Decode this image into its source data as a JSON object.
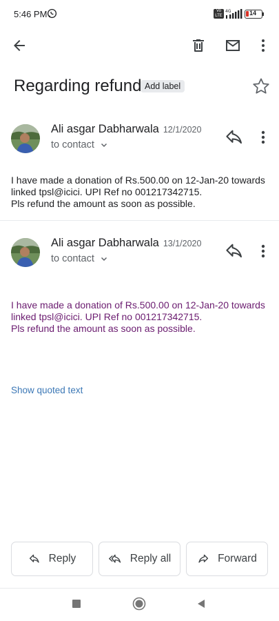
{
  "status_bar": {
    "time": "5:46 PM",
    "network_badge_line1": "Vo",
    "network_badge_line2": "LTE",
    "network_type": "4G",
    "battery": "14"
  },
  "toolbar": {
    "icons": [
      "back-arrow-icon",
      "trash-icon",
      "mail-icon",
      "more-vert-icon"
    ]
  },
  "subject": {
    "title": "Regarding refund",
    "label_chip": "Add label"
  },
  "messages": [
    {
      "sender": "Ali asgar Dabharwala",
      "date": "12/1/2020",
      "recipient": "to contact",
      "body": [
        "I have made a donation of Rs.500.00 on 12-Jan-20 towards",
        "linked tpsl@icici. UPI Ref no 001217342715.",
        "Pls refund the amount as soon as possible."
      ]
    },
    {
      "sender": "Ali asgar Dabharwala",
      "date": "13/1/2020",
      "recipient": "to contact",
      "body": [
        "I have made a donation of Rs.500.00 on 12-Jan-20 towards",
        "linked tpsl@icici. UPI Ref no 001217342715.",
        "Pls refund the amount as soon as possible."
      ]
    }
  ],
  "quoted_link": "Show quoted text",
  "actions": {
    "reply": "Reply",
    "reply_all": "Reply all",
    "forward": "Forward"
  },
  "colors": {
    "body_purple": "#6a1b6f",
    "link_blue": "#3c78b6",
    "battery_low": "#d93025"
  }
}
